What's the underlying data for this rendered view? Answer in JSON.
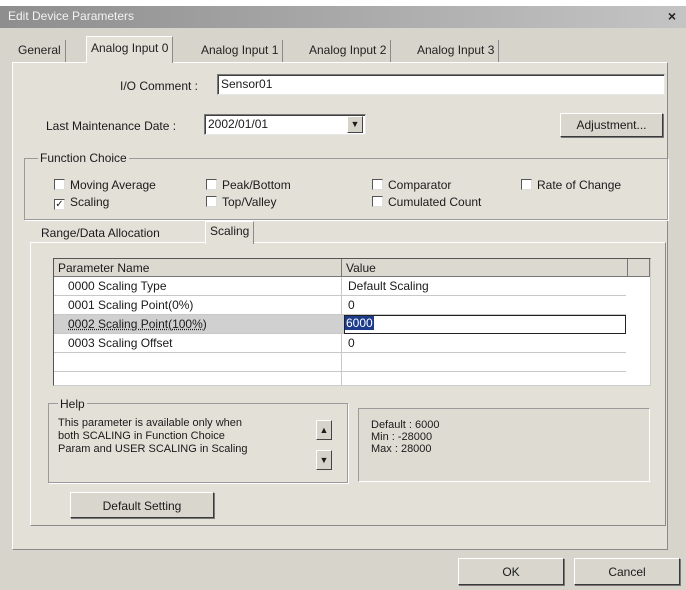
{
  "window": {
    "title": "Edit Device Parameters",
    "close_glyph": "×"
  },
  "tabs": [
    {
      "label": "General"
    },
    {
      "label": "Analog Input 0"
    },
    {
      "label": "Analog Input 1"
    },
    {
      "label": "Analog Input 2"
    },
    {
      "label": "Analog Input 3"
    }
  ],
  "form": {
    "io_comment_label": "I/O Comment :",
    "io_comment_value": "Sensor01",
    "maintenance_label": "Last Maintenance Date :",
    "maintenance_value": "2002/01/01",
    "adjustment_label": "Adjustment..."
  },
  "function_choice": {
    "title": "Function Choice",
    "options": [
      {
        "label": "Moving Average",
        "checked": false
      },
      {
        "label": "Peak/Bottom",
        "checked": false
      },
      {
        "label": "Comparator",
        "checked": false
      },
      {
        "label": "Rate of Change",
        "checked": false
      },
      {
        "label": "Scaling",
        "checked": true
      },
      {
        "label": "Top/Valley",
        "checked": false
      },
      {
        "label": "Cumulated Count",
        "checked": false
      }
    ]
  },
  "subtabs": [
    {
      "label": "Range/Data Allocation"
    },
    {
      "label": "Scaling"
    }
  ],
  "grid": {
    "headers": [
      "Parameter Name",
      "Value"
    ],
    "rows": [
      {
        "name": "0000 Scaling Type",
        "value": "Default Scaling"
      },
      {
        "name": "0001 Scaling Point(0%)",
        "value": "0"
      },
      {
        "name": "0002 Scaling Point(100%)",
        "value": "6000"
      },
      {
        "name": "0003 Scaling Offset",
        "value": "0"
      }
    ]
  },
  "help": {
    "title": "Help",
    "lines": [
      "This parameter is available only when",
      "both SCALING in Function Choice",
      "Param and USER SCALING in Scaling"
    ]
  },
  "range_info": {
    "lines": [
      "Default : 6000",
      "Min : -28000",
      "Max : 28000"
    ]
  },
  "buttons": {
    "default_setting": "Default Setting",
    "ok": "OK",
    "cancel": "Cancel"
  },
  "icons": {
    "dropdown": "▼",
    "scroll_up": "▲",
    "scroll_down": "▼",
    "check": "✓"
  }
}
